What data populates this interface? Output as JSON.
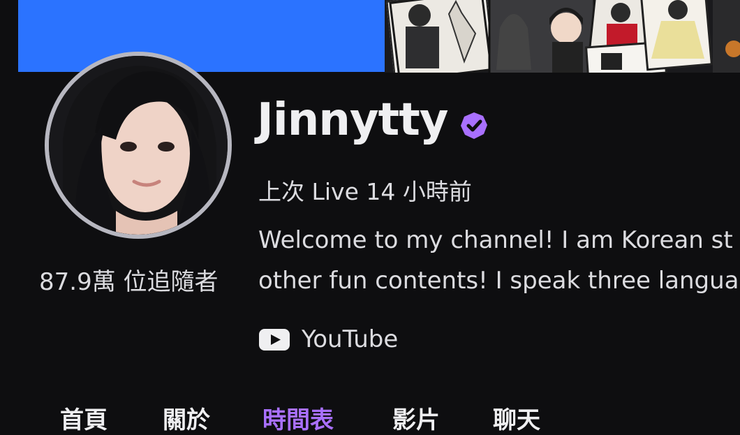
{
  "channel": {
    "name": "Jinnytty",
    "verified_icon": "verified-badge-icon",
    "last_live": "上次 Live 14 小時前",
    "description_line1": "Welcome to my channel! I am Korean st",
    "description_line2": "other fun contents! I speak three langua",
    "followers": "87.9萬 位追隨者"
  },
  "social": {
    "youtube_label": "YouTube",
    "youtube_icon": "youtube-icon"
  },
  "tabs": [
    "首頁",
    "關於",
    "時間表",
    "影片",
    "聊天"
  ],
  "active_tab_index": 2,
  "colors": {
    "accent": "#a970ff",
    "banner_blue": "#2b73ff",
    "background": "#0e0e10"
  }
}
